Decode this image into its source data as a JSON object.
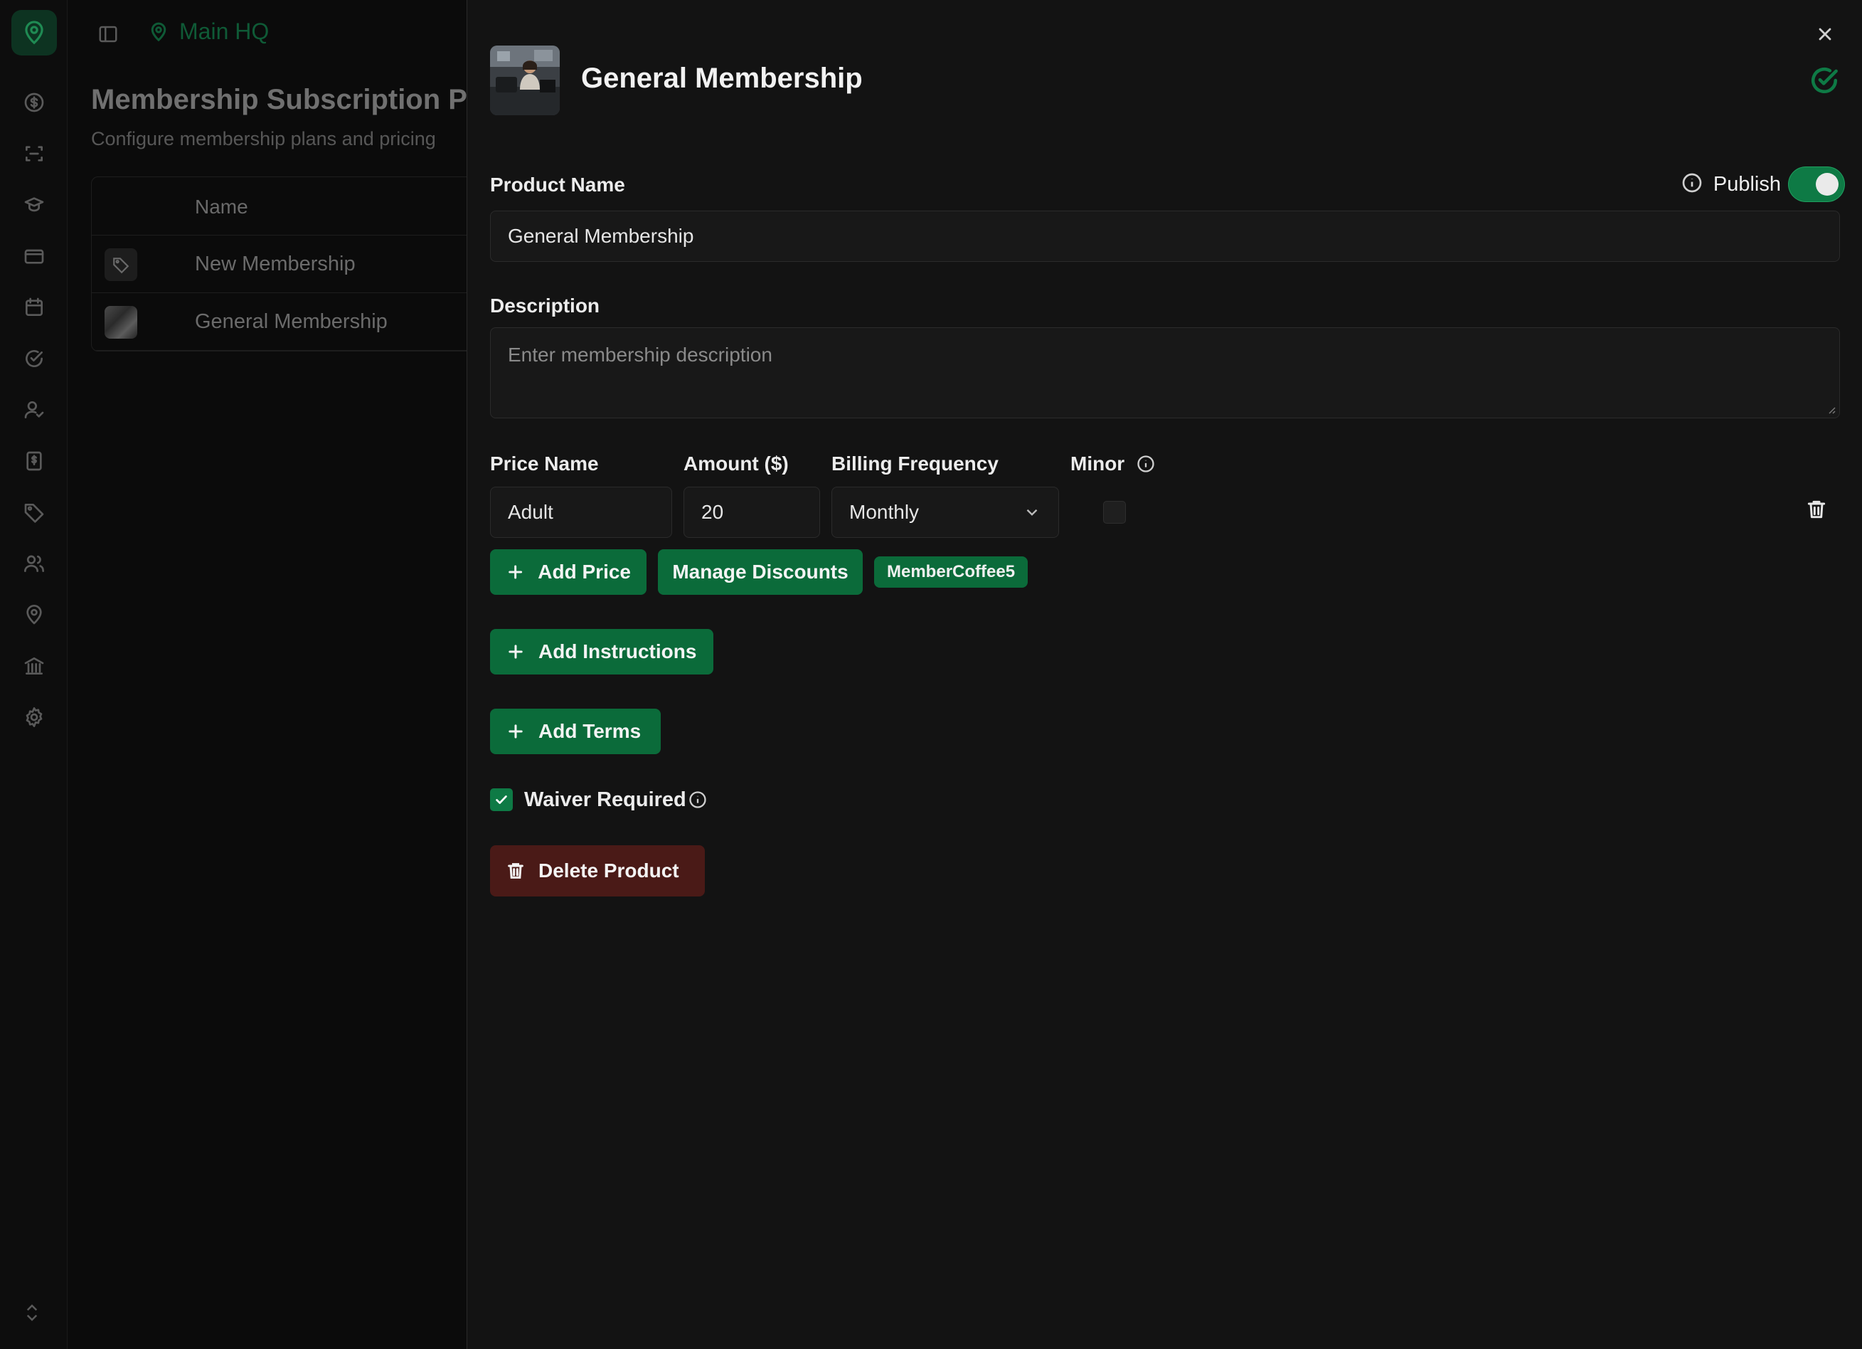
{
  "app": {
    "location": "Main HQ",
    "page_title": "Membership Subscription Pr",
    "page_subtitle": "Configure membership plans and pricing",
    "table": {
      "header_name": "Name",
      "rows": [
        {
          "name": "New Membership",
          "thumb": "tag-icon"
        },
        {
          "name": "General Membership",
          "thumb": "product-photo"
        }
      ]
    }
  },
  "sheet": {
    "title": "General Membership",
    "product_name_label": "Product Name",
    "product_name_value": "General Membership",
    "publish_label": "Publish",
    "publish_on": true,
    "description_label": "Description",
    "description_placeholder": "Enter membership description",
    "price": {
      "name_label": "Price Name",
      "amount_label": "Amount ($)",
      "frequency_label": "Billing Frequency",
      "minor_label": "Minor",
      "name_value": "Adult",
      "amount_value": "20",
      "frequency_value": "Monthly",
      "minor_checked": false
    },
    "buttons": {
      "add_price": "Add Price",
      "manage_discounts": "Manage Discounts",
      "add_instructions": "Add Instructions",
      "add_terms": "Add Terms",
      "delete_product": "Delete Product"
    },
    "discount_chip": "MemberCoffee5",
    "waiver_label": "Waiver Required",
    "waiver_checked": true
  },
  "colors": {
    "accent": "#0b6b3a",
    "accent_bright": "#0e7a45",
    "danger_bg": "#4a1a17",
    "sheet_bg": "#131313",
    "page_bg": "#0b0b0b"
  }
}
